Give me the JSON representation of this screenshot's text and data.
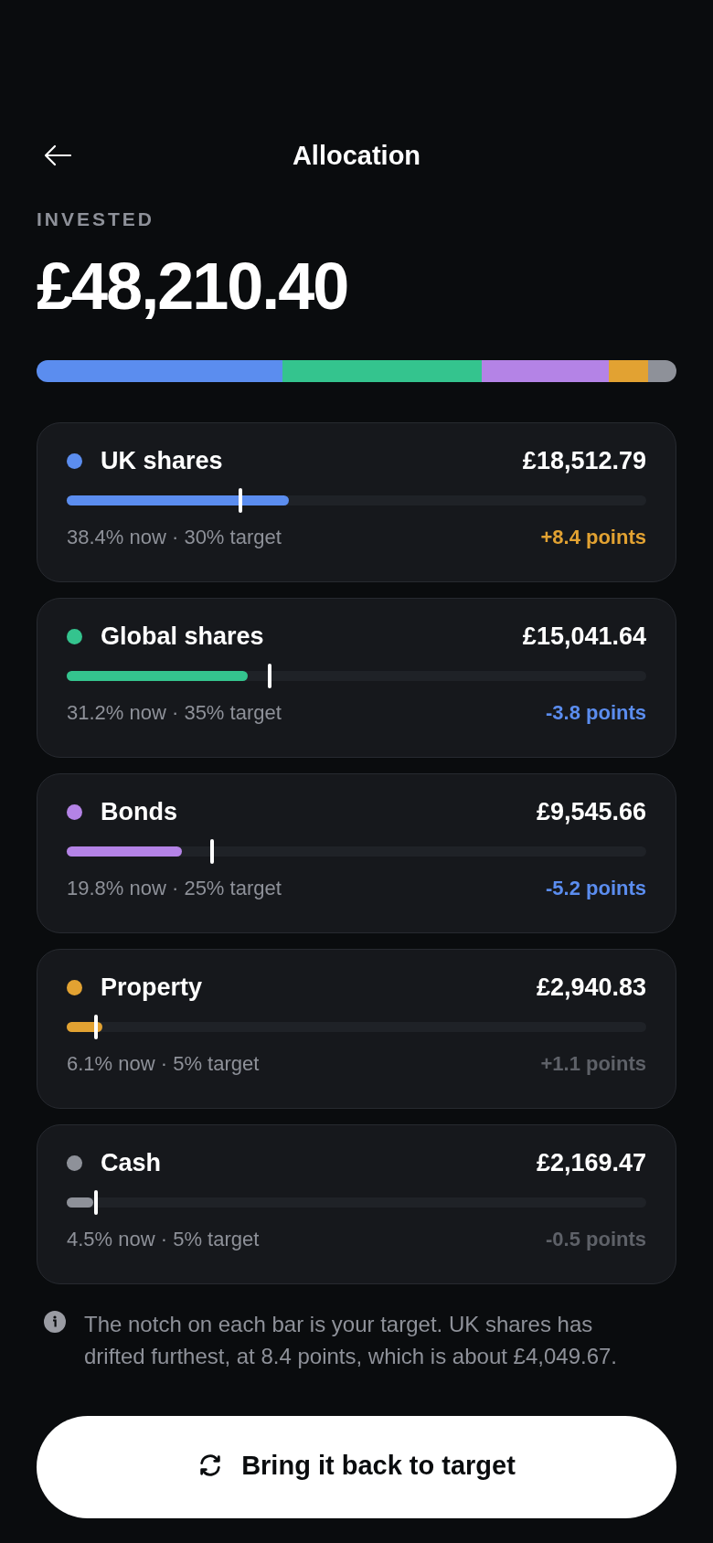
{
  "header": {
    "title": "Allocation"
  },
  "summary": {
    "label": "INVESTED",
    "amount": "£48,210.40"
  },
  "assets": [
    {
      "name": "UK shares",
      "color": "#5b8def",
      "amount": "£18,512.79",
      "level": 0.384,
      "target_marker": {
        "level": 0.3
      },
      "detail": "38.4% now · 30% target",
      "drift": {
        "text": "+8.4 points",
        "color": "#e2a232"
      }
    },
    {
      "name": "Global shares",
      "color": "#34c48e",
      "amount": "£15,041.64",
      "level": 0.312,
      "target_marker": {
        "level": 0.35
      },
      "detail": "31.2% now · 35% target",
      "drift": {
        "text": "-3.8 points",
        "color": "#5b8def"
      }
    },
    {
      "name": "Bonds",
      "color": "#b483e6",
      "amount": "£9,545.66",
      "level": 0.198,
      "target_marker": {
        "level": 0.25
      },
      "detail": "19.8% now · 25% target",
      "drift": {
        "text": "-5.2 points",
        "color": "#5b8def"
      }
    },
    {
      "name": "Property",
      "color": "#e2a232",
      "amount": "£2,940.83",
      "level": 0.061,
      "target_marker": {
        "level": 0.05
      },
      "detail": "6.1% now · 5% target",
      "drift": {
        "text": "+1.1 points",
        "color": "#5e6168"
      }
    },
    {
      "name": "Cash",
      "color": "#8e9199",
      "amount": "£2,169.47",
      "level": 0.045,
      "target_marker": {
        "level": 0.05
      },
      "detail": "4.5% now · 5% target",
      "drift": {
        "text": "-0.5 points",
        "color": "#5e6168"
      }
    }
  ],
  "note": "The notch on each bar is your target. UK shares has drifted furthest, at 8.4 points, which is about £4,049.67.",
  "action_button": {
    "label": "Bring it back to target"
  }
}
